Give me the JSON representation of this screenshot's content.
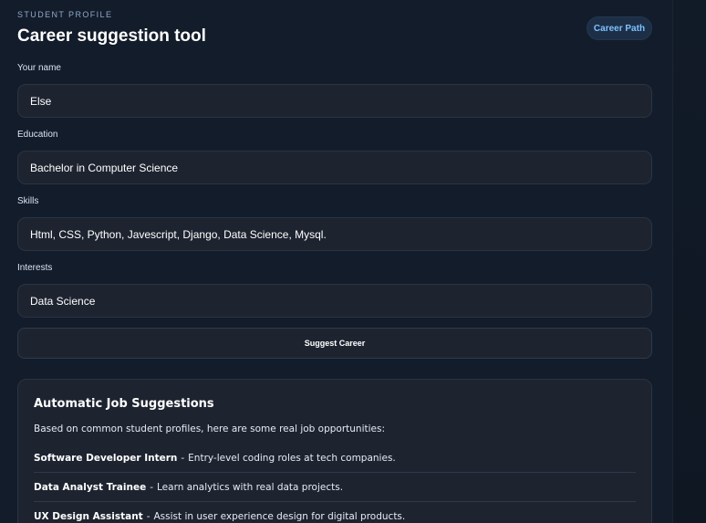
{
  "header": {
    "eyebrow": "STUDENT PROFILE",
    "title": "Career suggestion tool",
    "nav_pill": "Career Path"
  },
  "form": {
    "name": {
      "label": "Your name",
      "value": "Else"
    },
    "education": {
      "label": "Education",
      "value": "Bachelor in Computer Science"
    },
    "skills": {
      "label": "Skills",
      "value": "Html, CSS, Python, Javescript, Django, Data Science, Mysql."
    },
    "interests": {
      "label": "Interests",
      "value": "Data Science"
    },
    "submit_label": "Suggest Career"
  },
  "suggestions": {
    "title": "Automatic Job Suggestions",
    "intro": "Based on common student profiles, here are some real job opportunities:",
    "jobs": [
      {
        "role": "Software Developer Intern",
        "separator": "-",
        "description": "Entry-level coding roles at tech companies."
      },
      {
        "role": "Data Analyst Trainee",
        "separator": "-",
        "description": "Learn analytics with real data projects."
      },
      {
        "role": "UX Design Assistant",
        "separator": "-",
        "description": "Assist in user experience design for digital products."
      }
    ]
  },
  "colors": {
    "background": "#0f1723",
    "panel": "#131c2a",
    "field": "#1d2430",
    "accent": "#7cc2ff"
  }
}
